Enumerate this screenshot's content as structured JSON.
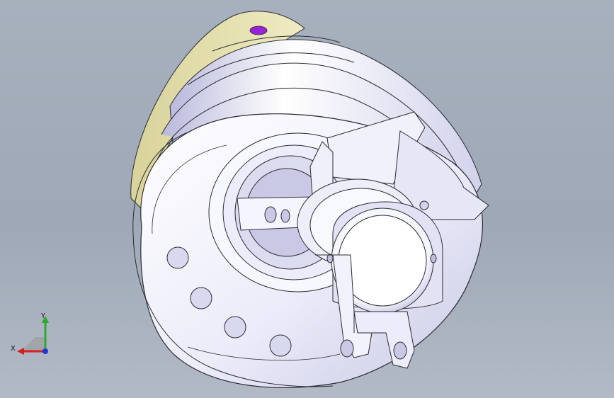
{
  "viewport": {
    "background_top": "#a7b1be",
    "background_bottom": "#b2bac6"
  },
  "model": {
    "description_icon": "turbocharger-3d-model-icon",
    "body_color": "#f4f4ff",
    "edge_color": "#2b2b33",
    "shade_color": "#c9c9e6",
    "accent_yellow": "#e8e3b0",
    "accent_purple": "#9a22d6"
  },
  "triad": {
    "x_label": "X",
    "y_label": "Y",
    "x_color": "#d61f1f",
    "y_color": "#2ea82e",
    "z_color": "#1f38d6"
  }
}
